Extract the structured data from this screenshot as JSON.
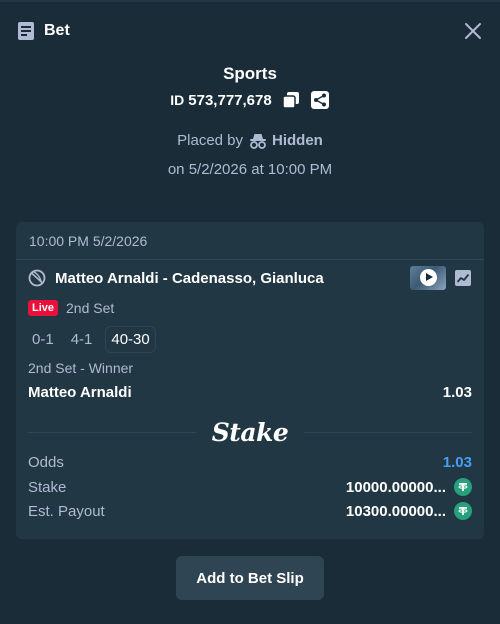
{
  "header": {
    "title": "Bet"
  },
  "bet": {
    "section": "Sports",
    "id_prefix": "ID",
    "id_value": "573,777,678",
    "placed_by_label": "Placed by",
    "placed_by_user": "Hidden",
    "placed_on": "on 5/2/2026 at 10:00 PM"
  },
  "card": {
    "datetime": "10:00 PM 5/2/2026",
    "event": "Matteo Arnaldi - Cadenasso, Gianluca",
    "live_label": "Live",
    "set_label": "2nd Set",
    "scores": [
      "0-1",
      "4-1",
      "40-30"
    ],
    "market": "2nd Set - Winner",
    "selection": "Matteo Arnaldi",
    "selection_odds": "1.03",
    "logo_text": "Stake",
    "odds_label": "Odds",
    "odds_value": "1.03",
    "stake_label": "Stake",
    "stake_value": "10000.00000...",
    "payout_label": "Est. Payout",
    "payout_value": "10300.00000..."
  },
  "actions": {
    "add_to_slip": "Add to Bet Slip"
  },
  "colors": {
    "background": "#1a2c38",
    "card": "#213743",
    "live": "#e9113c",
    "odds": "#4a9cf5",
    "tether": "#26a17b"
  }
}
